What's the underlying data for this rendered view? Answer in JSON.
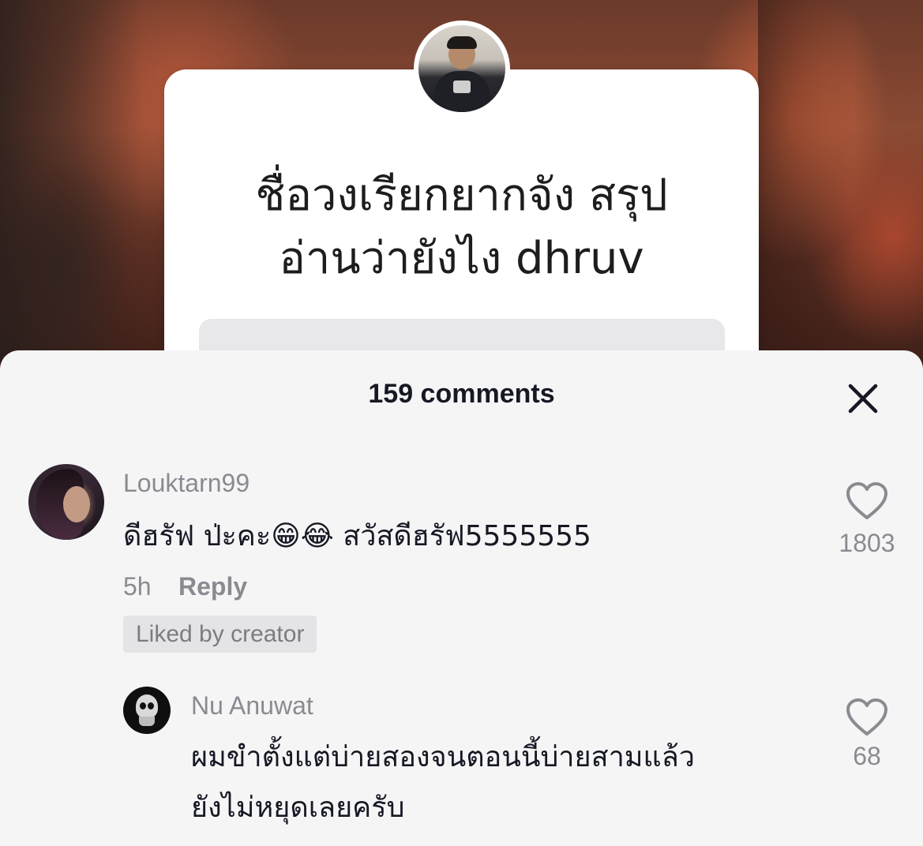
{
  "video": {
    "question_line1": "ชื่อวงเรียกยากจัง สรุป",
    "question_line2": "อ่านว่ายังไง dhruv"
  },
  "comments_sheet": {
    "title": "159 comments",
    "close_icon": "close-icon"
  },
  "comments": [
    {
      "username": "Louktarn99",
      "text": "ดีฮรัฟ ป่ะคะ😁😂 สวัสดีฮรัฟ5555555",
      "time": "5h",
      "reply_label": "Reply",
      "badge": "Liked by creator",
      "likes": "1803"
    },
    {
      "username": "Nu Anuwat",
      "text_line1": "ผมขำตั้งแต่บ่ายสองจนตอนนี้บ่ายสามแล้ว",
      "text_line2": "ยังไม่หยุดเลยครับ",
      "likes": "68"
    }
  ],
  "colors": {
    "sheet_bg": "#f5f5f6",
    "primary_text": "#161823",
    "secondary_text": "#8a8b91"
  }
}
